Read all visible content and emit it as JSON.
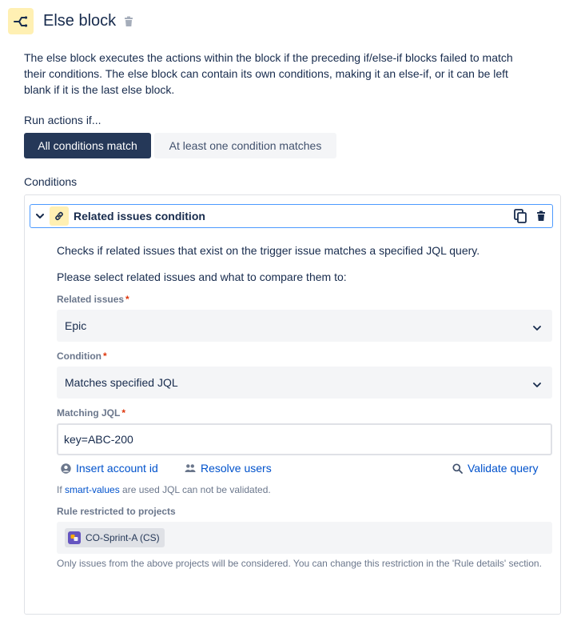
{
  "header": {
    "title": "Else block",
    "block_icon": "branch-icon",
    "trash_icon": "trash-icon"
  },
  "description": "The else block executes the actions within the block if the preceding if/else-if blocks failed to match their conditions. The else block can contain its own conditions, making it an else-if, or it can be left blank if it is the last else block.",
  "run_actions": {
    "label": "Run actions if...",
    "options": [
      "All conditions match",
      "At least one condition matches"
    ],
    "selected": "All conditions match"
  },
  "conditions": {
    "label": "Conditions",
    "item": {
      "title": "Related issues condition",
      "summary": "Checks if related issues that exist on the trigger issue matches a specified JQL query.",
      "instruction": "Please select related issues and what to compare them to:",
      "related_issues": {
        "label": "Related issues",
        "required_mark": "*",
        "value": "Epic"
      },
      "condition": {
        "label": "Condition",
        "required_mark": "*",
        "value": "Matches specified JQL"
      },
      "matching_jql": {
        "label": "Matching JQL",
        "required_mark": "*",
        "value": "key=ABC-200"
      },
      "actions": {
        "insert_account_id": "Insert account id",
        "resolve_users": "Resolve users",
        "validate_query": "Validate query"
      },
      "validation_note": {
        "prefix": "If",
        "link": "smart-values",
        "suffix": "are used JQL can not be validated."
      },
      "restricted": {
        "label": "Rule restricted to projects",
        "project": "CO-Sprint-A (CS)",
        "note": "Only issues from the above projects will be considered. You can change this restriction in the 'Rule details' section."
      }
    }
  },
  "colors": {
    "primary_dark": "#253858",
    "link": "#0052cc",
    "accent_yellow": "#fff0b3",
    "focus_border": "#4c9aff",
    "required": "#de350b",
    "project_avatar": "#6554c0"
  }
}
